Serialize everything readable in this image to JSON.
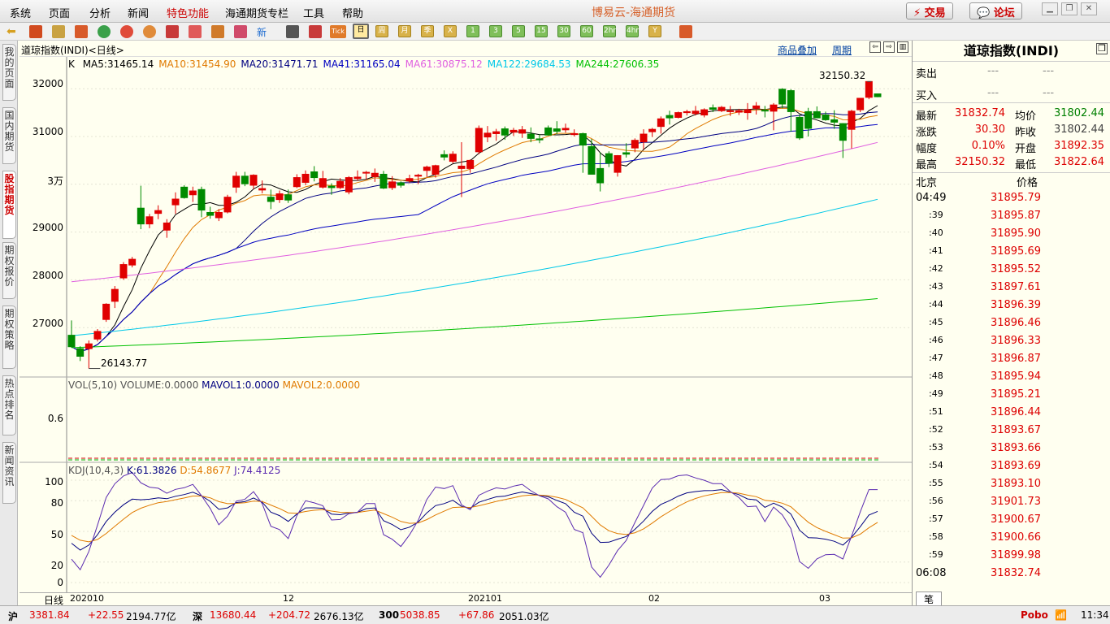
{
  "menu": [
    "系统",
    "页面",
    "分析",
    "新闻",
    "特色功能",
    "海通期货专栏",
    "工具",
    "帮助"
  ],
  "app_title": "博易云-海通期货",
  "top_buttons": {
    "trade": "交易",
    "forum": "论坛"
  },
  "toolbar": {
    "periods": [
      "日",
      "周",
      "月",
      "季",
      "X",
      "1",
      "3",
      "5",
      "15",
      "30",
      "60",
      "2hr",
      "4hr",
      "Y"
    ],
    "active_period": "日"
  },
  "left_tabs": [
    "我的页面",
    "国内期货",
    "股指期货",
    "期权报价",
    "期权策略",
    "热点排名",
    "新闻资讯"
  ],
  "chart": {
    "title": "道琼指数(INDI)<日线>",
    "overlay_link": "商品叠加",
    "period_link": "周期",
    "k_label": "K",
    "ma": [
      {
        "t": "MA5:31465.14",
        "c": "#000000"
      },
      {
        "t": "MA10:31454.90",
        "c": "#e07a00"
      },
      {
        "t": "MA20:31471.71",
        "c": "#000080"
      },
      {
        "t": "MA41:31165.04",
        "c": "#0000c0"
      },
      {
        "t": "MA61:30875.12",
        "c": "#e060e0"
      },
      {
        "t": "MA122:29684.53",
        "c": "#00c8e8"
      },
      {
        "t": "MA244:27606.35",
        "c": "#00c000"
      }
    ],
    "price_axis": [
      "32000",
      "31000",
      "3万",
      "29000",
      "28000",
      "27000"
    ],
    "high_label": "32150.32",
    "low_label": "26143.77",
    "vol_header": {
      "t1": "VOL(5,10)",
      "t2": "VOLUME:0.0000",
      "t3": "MAVOL1:0.0000",
      "t4": "MAVOL2:0.0000"
    },
    "vol_axis": "0.6",
    "kdj_header": {
      "t1": "KDJ(10,4,3)",
      "k": "K:61.3826",
      "d": "D:54.8677",
      "j": "J:74.4125"
    },
    "kdj_axis": [
      "100",
      "80",
      "50",
      "20",
      "0"
    ],
    "x_axis": {
      "label": "日线",
      "ticks": [
        "202010",
        "12",
        "202101",
        "02",
        "03"
      ]
    }
  },
  "chart_data": {
    "type": "candlestick",
    "ylim": [
      26000,
      32400
    ],
    "candles": [
      [
        26840,
        27150,
        26580,
        26600
      ],
      [
        26560,
        26610,
        26300,
        26400
      ],
      [
        26560,
        26730,
        26143.77,
        26660
      ],
      [
        26760,
        26970,
        26710,
        26920
      ],
      [
        27170,
        27510,
        27120,
        27490
      ],
      [
        27550,
        27870,
        27410,
        27800
      ],
      [
        28040,
        28370,
        28000,
        28320
      ],
      [
        28310,
        28480,
        28260,
        28430
      ],
      [
        29500,
        29970,
        29060,
        29170
      ],
      [
        29170,
        29380,
        29080,
        29320
      ],
      [
        29390,
        29560,
        29270,
        29450
      ],
      [
        29040,
        29270,
        28880,
        29190
      ],
      [
        29570,
        29830,
        29380,
        29690
      ],
      [
        29940,
        29980,
        29700,
        29720
      ],
      [
        29780,
        29950,
        29630,
        29860
      ],
      [
        29890,
        29950,
        29310,
        29460
      ],
      [
        29410,
        29530,
        29280,
        29350
      ],
      [
        29300,
        29480,
        29230,
        29410
      ],
      [
        29420,
        29780,
        29390,
        29730
      ],
      [
        29940,
        30260,
        29820,
        30170
      ],
      [
        30170,
        30260,
        29960,
        30010
      ],
      [
        29980,
        30210,
        29900,
        30190
      ],
      [
        29880,
        30080,
        29810,
        29910
      ],
      [
        29730,
        29890,
        29480,
        29640
      ],
      [
        29680,
        29870,
        29610,
        29800
      ],
      [
        29780,
        29890,
        29610,
        29670
      ],
      [
        29950,
        30210,
        29920,
        30140
      ],
      [
        30040,
        30290,
        29980,
        30210
      ],
      [
        30260,
        30380,
        30060,
        30140
      ],
      [
        29940,
        30280,
        29910,
        30120
      ],
      [
        29960,
        30020,
        29780,
        29930
      ],
      [
        29930,
        30130,
        29900,
        30060
      ],
      [
        29840,
        30170,
        29790,
        30140
      ],
      [
        30120,
        30290,
        30070,
        30150
      ],
      [
        30240,
        30280,
        30100,
        30250
      ],
      [
        30160,
        30330,
        30050,
        30230
      ],
      [
        30210,
        30280,
        29900,
        29920
      ],
      [
        29930,
        30170,
        29880,
        30050
      ],
      [
        30030,
        30060,
        29930,
        29980
      ],
      [
        30070,
        30200,
        30030,
        30120
      ],
      [
        30170,
        30220,
        30000,
        30190
      ],
      [
        30290,
        30390,
        30150,
        30360
      ],
      [
        30210,
        30410,
        30140,
        30390
      ],
      [
        30620,
        30710,
        30500,
        30570
      ],
      [
        30480,
        30690,
        30440,
        30630
      ],
      [
        30330,
        30880,
        29730,
        30380
      ],
      [
        30330,
        30520,
        30240,
        30500
      ],
      [
        30680,
        31230,
        30630,
        31170
      ],
      [
        30990,
        31220,
        30880,
        31070
      ],
      [
        31060,
        31160,
        30910,
        31100
      ],
      [
        31160,
        31210,
        30930,
        31030
      ],
      [
        31090,
        31180,
        31010,
        31130
      ],
      [
        31070,
        31220,
        30970,
        31140
      ],
      [
        31050,
        31190,
        30880,
        30960
      ],
      [
        30950,
        31050,
        30860,
        30930
      ],
      [
        31180,
        31230,
        31020,
        31030
      ],
      [
        31160,
        31320,
        31050,
        31110
      ],
      [
        31140,
        31270,
        31080,
        31170
      ],
      [
        31040,
        31150,
        31000,
        31060
      ],
      [
        31060,
        31080,
        30240,
        30820
      ],
      [
        30790,
        30950,
        30230,
        30210
      ],
      [
        30330,
        30670,
        29850,
        30030
      ],
      [
        30640,
        30690,
        30360,
        30440
      ],
      [
        30250,
        30610,
        30160,
        30600
      ],
      [
        30660,
        30860,
        30560,
        30630
      ],
      [
        30760,
        30960,
        30670,
        30920
      ],
      [
        30890,
        31150,
        30730,
        31050
      ],
      [
        31100,
        31180,
        30990,
        31150
      ],
      [
        31210,
        31420,
        31060,
        31370
      ],
      [
        31440,
        31540,
        31250,
        31390
      ],
      [
        31400,
        31520,
        31380,
        31500
      ],
      [
        31500,
        31560,
        31440,
        31520
      ],
      [
        31480,
        31640,
        31440,
        31530
      ],
      [
        31450,
        31590,
        31400,
        31560
      ],
      [
        31600,
        31670,
        31510,
        31570
      ],
      [
        31540,
        31640,
        31510,
        31610
      ],
      [
        31520,
        31640,
        31430,
        31540
      ],
      [
        31510,
        31580,
        31450,
        31540
      ],
      [
        31500,
        31700,
        31350,
        31560
      ],
      [
        31590,
        31720,
        31460,
        31640
      ],
      [
        31550,
        31640,
        31400,
        31540
      ],
      [
        31530,
        31700,
        31130,
        31660
      ],
      [
        31990,
        32010,
        31590,
        31680
      ],
      [
        31960,
        31990,
        31100,
        31520
      ],
      [
        31400,
        31460,
        30930,
        30970
      ],
      [
        31520,
        31600,
        31000,
        31170
      ],
      [
        31520,
        31630,
        31390,
        31390
      ],
      [
        31450,
        31520,
        31330,
        31350
      ],
      [
        31350,
        31550,
        31160,
        31300
      ],
      [
        31270,
        31280,
        30550,
        30920
      ],
      [
        31150,
        31560,
        30750,
        31530
      ],
      [
        31560,
        31770,
        31510,
        31800
      ],
      [
        31820,
        32150.32,
        31780,
        32150.32
      ],
      [
        31892.35,
        31892.35,
        31822.64,
        31832.74
      ]
    ]
  },
  "quote": {
    "title": "道琼指数(INDI)",
    "sell_label": "卖出",
    "buy_label": "买入",
    "dash": "---",
    "latest_label": "最新",
    "latest": "31832.74",
    "avg_label": "均价",
    "avg": "31802.44",
    "change_label": "涨跌",
    "change": "30.30",
    "prev_label": "昨收",
    "prev": "31802.44",
    "range_label": "幅度",
    "range": "0.10%",
    "open_label": "开盘",
    "open": "31892.35",
    "high_label": "最高",
    "high": "32150.32",
    "low_label": "最低",
    "low": "31822.64",
    "ticks_header": {
      "city": "北京",
      "price": "价格"
    },
    "ticks": [
      {
        "t": "04:49",
        "p": "31895.79"
      },
      {
        "t": ":39",
        "p": "31895.87"
      },
      {
        "t": ":40",
        "p": "31895.90"
      },
      {
        "t": ":41",
        "p": "31895.69"
      },
      {
        "t": ":42",
        "p": "31895.52"
      },
      {
        "t": ":43",
        "p": "31897.61"
      },
      {
        "t": ":44",
        "p": "31896.39"
      },
      {
        "t": ":45",
        "p": "31896.46"
      },
      {
        "t": ":46",
        "p": "31896.33"
      },
      {
        "t": ":47",
        "p": "31896.87"
      },
      {
        "t": ":48",
        "p": "31895.94"
      },
      {
        "t": ":49",
        "p": "31895.21"
      },
      {
        "t": ":51",
        "p": "31896.44"
      },
      {
        "t": ":52",
        "p": "31893.67"
      },
      {
        "t": ":53",
        "p": "31893.66"
      },
      {
        "t": ":54",
        "p": "31893.69"
      },
      {
        "t": ":55",
        "p": "31893.10"
      },
      {
        "t": ":56",
        "p": "31901.73"
      },
      {
        "t": ":57",
        "p": "31900.67"
      },
      {
        "t": ":58",
        "p": "31900.66"
      },
      {
        "t": ":59",
        "p": "31899.98"
      },
      {
        "t": "06:08",
        "p": "31832.74"
      }
    ],
    "bottom_tab": "笔"
  },
  "status": {
    "sh_label": "沪",
    "sh": "3381.84",
    "sh_chg": "+22.55",
    "sh_amt": "2194.77亿",
    "sz_label": "深",
    "sz": "13680.44",
    "sz_chg": "+204.72",
    "sz_amt": "2676.13亿",
    "hs_label": "300",
    "hs": "5038.85",
    "hs_chg": "+67.86",
    "hs_amt": "2051.03亿",
    "brand": "Pobo",
    "time": "11:34"
  }
}
